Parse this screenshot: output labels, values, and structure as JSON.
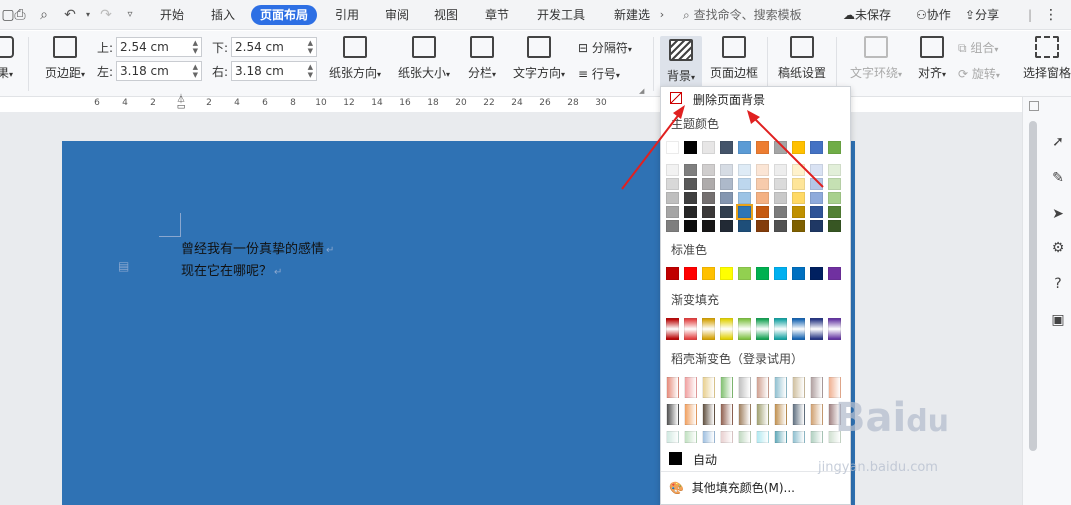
{
  "tabbar": {
    "tabs": [
      "开始",
      "插入",
      "页面布局",
      "引用",
      "审阅",
      "视图",
      "章节",
      "开发工具",
      "新建选"
    ],
    "active_tab": "页面布局",
    "search_placeholder": "查找命令、搜索模板",
    "unsaved": "未保存",
    "collab": "协作",
    "share": "分享"
  },
  "ribbon": {
    "effects_partial": "果",
    "margin_btn": "页边距",
    "margin_top_label": "上:",
    "margin_top_value": "2.54 cm",
    "margin_bottom_label": "下:",
    "margin_bottom_value": "2.54 cm",
    "margin_left_label": "左:",
    "margin_left_value": "3.18 cm",
    "margin_right_label": "右:",
    "margin_right_value": "3.18 cm",
    "orientation": "纸张方向",
    "paper_size": "纸张大小",
    "columns": "分栏",
    "text_dir": "文字方向",
    "separator": "分隔符",
    "line_num": "行号",
    "background": "背景",
    "page_border": "页面边框",
    "paper_setup": "稿纸设置",
    "text_wrap": "文字环绕",
    "align": "对齐",
    "group": "组合",
    "rotate": "旋转",
    "select_pane": "选择窗格"
  },
  "ruler": {
    "numbers": [
      "6",
      "4",
      "2",
      "2",
      "4",
      "6",
      "8",
      "10",
      "12",
      "14",
      "16",
      "18",
      "20",
      "22",
      "24",
      "26",
      "28",
      "30"
    ]
  },
  "document": {
    "line1": "曾经我有一份真挚的感情",
    "line2": "现在它在哪呢？"
  },
  "dropdown": {
    "remove_bg": "删除页面背景",
    "theme_colors": "主题颜色",
    "standard_colors": "标准色",
    "gradient_fill": "渐变填充",
    "shell_gradient": "稻壳渐变色（登录试用）",
    "auto": "自动",
    "more_colors": "其他填充颜色(M)...",
    "theme_top": [
      "#ffffff",
      "#000000",
      "#e7e6e6",
      "#44546a",
      "#5b9bd5",
      "#ed7d31",
      "#a5a5a5",
      "#ffc000",
      "#4472c4",
      "#70ad47"
    ],
    "theme_rows": [
      [
        "#f2f2f2",
        "#7f7f7f",
        "#d0cece",
        "#d6dce4",
        "#deebf6",
        "#fbe5d5",
        "#ededed",
        "#fff2cc",
        "#d9e2f3",
        "#e2efd9"
      ],
      [
        "#d8d8d8",
        "#595959",
        "#aeabab",
        "#adb9ca",
        "#bdd7ee",
        "#f7cbac",
        "#dbdbdb",
        "#fee599",
        "#b4c6e7",
        "#c5e0b3"
      ],
      [
        "#bfbfbf",
        "#3f3f3f",
        "#757070",
        "#8496b0",
        "#9cc3e5",
        "#f4b183",
        "#c9c9c9",
        "#ffd965",
        "#8eaadb",
        "#a8d08d"
      ],
      [
        "#a5a5a5",
        "#262626",
        "#3a3838",
        "#323f4f",
        "#2e75b5",
        "#c55a11",
        "#7b7b7b",
        "#bf9000",
        "#2f5496",
        "#538135"
      ],
      [
        "#7f7f7f",
        "#0c0c0c",
        "#171616",
        "#222a35",
        "#1e4e79",
        "#833c0b",
        "#525252",
        "#7f6000",
        "#1f3864",
        "#375623"
      ]
    ],
    "standard": [
      "#c00000",
      "#ff0000",
      "#ffc000",
      "#ffff00",
      "#92d050",
      "#00b050",
      "#00b0f0",
      "#0070c0",
      "#002060",
      "#7030a0"
    ],
    "gradients": [
      "#b80000",
      "#e23b3b",
      "#d4a000",
      "#e0d000",
      "#7cc040",
      "#10a050",
      "#10a0a0",
      "#1060b0",
      "#203080",
      "#6030a0"
    ],
    "shell_row1": [
      "#e58a7a",
      "#f0a0a0",
      "#e8d090",
      "#80c070",
      "#c0c0c0",
      "#d0a090",
      "#90c0d0",
      "#d0c0a0",
      "#b0a0a0",
      "#f0b090"
    ],
    "shell_row2": [
      "#505050",
      "#f0a060",
      "#605040",
      "#906050",
      "#a08060",
      "#a0a070",
      "#c09050",
      "#607080",
      "#d0a070",
      "#a08080"
    ],
    "shell_row3": [
      "#d0e8e0",
      "#c0e0c0",
      "#a0c0e0",
      "#e8d0d0",
      "#c0d8c0",
      "#b0e8f0",
      "#60a8b8",
      "#90c0d0",
      "#b0d0c0",
      "#d0e0d0"
    ]
  }
}
